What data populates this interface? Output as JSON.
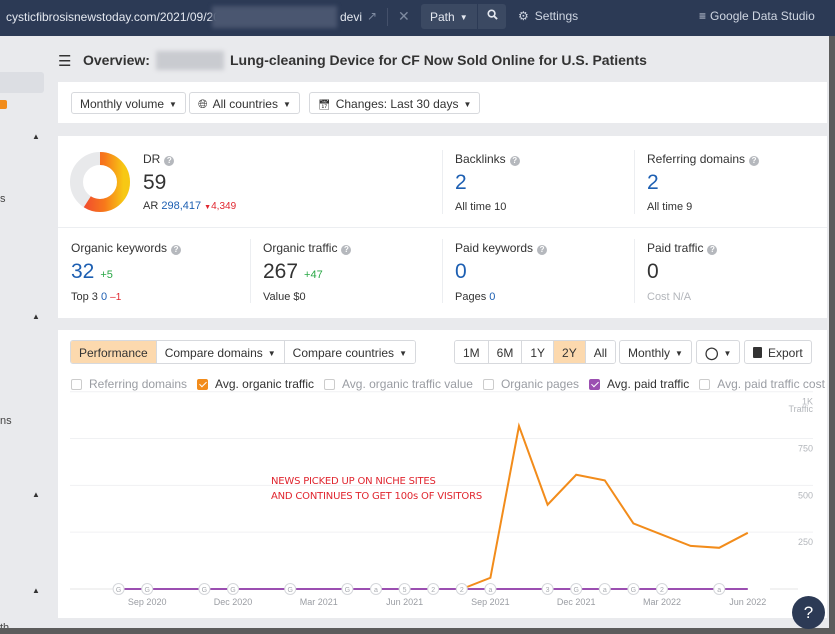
{
  "topbar": {
    "url": "cysticfibrosisnewstoday.com/2021/09/20",
    "url_suffix": "devi",
    "external_icon": "external-link-icon",
    "close_icon": "close-icon",
    "mode_label": "Path",
    "search_icon": "search-icon",
    "settings_label": "Settings",
    "gds_label": "Google Data Studio"
  },
  "sidebar": {
    "fragments": [
      "s",
      "ns",
      "th"
    ]
  },
  "header": {
    "title_prefix": "Overview:",
    "title": "Lung-cleaning Device for CF Now Sold Online for U.S. Patients"
  },
  "filters": {
    "volume": "Monthly volume",
    "countries": "All countries",
    "changes": "Changes: Last 30 days"
  },
  "metrics": {
    "dr": {
      "label": "DR",
      "value": "59",
      "ar_label": "AR",
      "ar_value": "298,417",
      "ar_delta": "4,349",
      "donut_fraction": 0.59
    },
    "backlinks": {
      "label": "Backlinks",
      "value": "2",
      "sub_label": "All time",
      "sub_value": "10"
    },
    "referring_domains": {
      "label": "Referring domains",
      "value": "2",
      "sub_label": "All time",
      "sub_value": "9"
    },
    "organic_keywords": {
      "label": "Organic keywords",
      "value": "32",
      "delta": "+5",
      "sub_label": "Top 3",
      "sub_value": "0",
      "sub_delta": "–1"
    },
    "organic_traffic": {
      "label": "Organic traffic",
      "value": "267",
      "delta": "+47",
      "sub_label": "Value",
      "sub_value": "$0"
    },
    "paid_keywords": {
      "label": "Paid keywords",
      "value": "0",
      "sub_label": "Pages",
      "sub_value": "0"
    },
    "paid_traffic": {
      "label": "Paid traffic",
      "value": "0",
      "sub_label": "Cost",
      "sub_value": "N/A"
    }
  },
  "chart_controls": {
    "tabs": [
      "Performance",
      "Compare domains",
      "Compare countries"
    ],
    "active_tab": "Performance",
    "ranges": [
      "1M",
      "6M",
      "1Y",
      "2Y",
      "All"
    ],
    "active_range": "2Y",
    "interval": "Monthly",
    "annotation_icon": "comment-icon",
    "export_label": "Export"
  },
  "legend": [
    {
      "label": "Referring domains",
      "checked": false,
      "color": ""
    },
    {
      "label": "Avg. organic traffic",
      "checked": true,
      "color": "#f28c1b"
    },
    {
      "label": "Avg. organic traffic value",
      "checked": false,
      "color": ""
    },
    {
      "label": "Organic pages",
      "checked": false,
      "color": ""
    },
    {
      "label": "Avg. paid traffic",
      "checked": true,
      "color": "#9b4fb1"
    },
    {
      "label": "Avg. paid traffic cost",
      "checked": false,
      "color": ""
    }
  ],
  "chart_data": {
    "type": "line",
    "ylabel": "Traffic",
    "yticks": [
      "1K",
      "750",
      "500",
      "250"
    ],
    "ytick_values": [
      1000,
      750,
      500,
      250
    ],
    "ylim": [
      0,
      1100
    ],
    "xtick_labels": [
      "Sep 2020",
      "Dec 2020",
      "Mar 2021",
      "Jun 2021",
      "Sep 2021",
      "Dec 2021",
      "Mar 2022",
      "Jun 2022"
    ],
    "x": [
      "Jul 2020",
      "Aug 2020",
      "Sep 2020",
      "Oct 2020",
      "Nov 2020",
      "Dec 2020",
      "Jan 2021",
      "Feb 2021",
      "Mar 2021",
      "Apr 2021",
      "May 2021",
      "Jun 2021",
      "Jul 2021",
      "Aug 2021",
      "Sep 2021",
      "Oct 2021",
      "Nov 2021",
      "Dec 2021",
      "Jan 2022",
      "Feb 2022",
      "Mar 2022",
      "Apr 2022",
      "May 2022",
      "Jun 2022"
    ],
    "series": [
      {
        "name": "Avg. organic traffic",
        "color": "#f28c1b",
        "values": [
          null,
          null,
          null,
          null,
          null,
          null,
          null,
          null,
          null,
          null,
          null,
          null,
          null,
          0,
          60,
          870,
          450,
          610,
          580,
          350,
          290,
          230,
          220,
          300
        ]
      },
      {
        "name": "Avg. paid traffic",
        "color": "#9b4fb1",
        "values": [
          null,
          0,
          0,
          0,
          0,
          0,
          0,
          0,
          0,
          0,
          0,
          0,
          0,
          0,
          0,
          0,
          0,
          0,
          0,
          0,
          0,
          0,
          0,
          0
        ]
      }
    ],
    "annotations_markers": [
      {
        "x": "Aug 2020",
        "label": "G"
      },
      {
        "x": "Sep 2020",
        "label": "G"
      },
      {
        "x": "Nov 2020",
        "label": "G"
      },
      {
        "x": "Dec 2020",
        "label": "G"
      },
      {
        "x": "Feb 2021",
        "label": "G"
      },
      {
        "x": "Apr 2021",
        "label": "G"
      },
      {
        "x": "May 2021",
        "label": "a"
      },
      {
        "x": "Jun 2021",
        "label": "5"
      },
      {
        "x": "Jul 2021",
        "label": "2"
      },
      {
        "x": "Aug 2021",
        "label": "2"
      },
      {
        "x": "Sep 2021",
        "label": "a"
      },
      {
        "x": "Nov 2021",
        "label": "3"
      },
      {
        "x": "Dec 2021",
        "label": "G"
      },
      {
        "x": "Jan 2022",
        "label": "a"
      },
      {
        "x": "Feb 2022",
        "label": "G"
      },
      {
        "x": "Mar 2022",
        "label": "2"
      },
      {
        "x": "May 2022",
        "label": "a"
      }
    ],
    "text_annotation": [
      "NEWS PICKED UP ON NICHE SITES",
      "AND CONTINUES TO GET 100s OF VISITORS"
    ],
    "text_annotation_color": "#e0262f",
    "grid": true,
    "legend": "top"
  },
  "help_label": "?"
}
